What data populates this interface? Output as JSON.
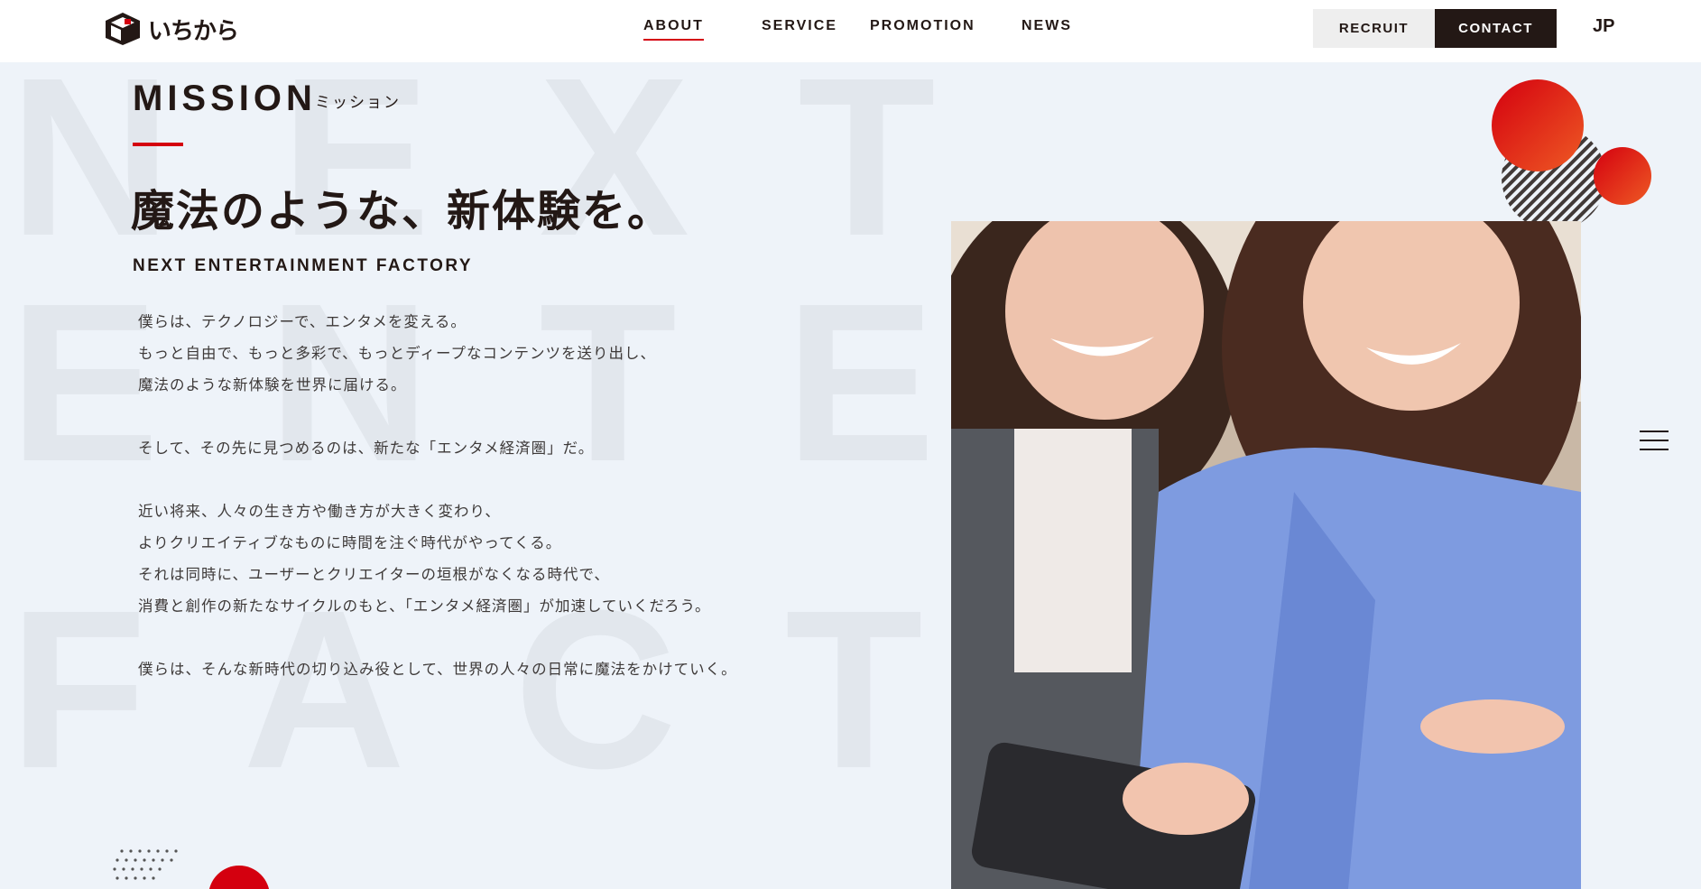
{
  "header": {
    "logo_text": "いちから",
    "nav": [
      {
        "label": "ABOUT",
        "active": true
      },
      {
        "label": "SERVICE",
        "active": false
      },
      {
        "label": "PROMOTION",
        "active": false
      },
      {
        "label": "NEWS",
        "active": false
      }
    ],
    "recruit_label": "RECRUIT",
    "contact_label": "CONTACT",
    "lang_label": "JP"
  },
  "background_text": {
    "row1": "NEXT",
    "row2": "ENTE",
    "row3": "FACTO"
  },
  "mission": {
    "heading": "MISSION",
    "subheading": "ミッション",
    "catch_copy": "魔法のような、新体験を。",
    "catch_en": "NEXT ENTERTAINMENT FACTORY",
    "paragraphs": [
      [
        "僕らは、テクノロジーで、エンタメを変える。",
        "もっと自由で、もっと多彩で、もっとディープなコンテンツを送り出し、",
        "魔法のような新体験を世界に届ける。"
      ],
      [
        "そして、その先に見つめるのは、新たな「エンタメ経済圏」だ。"
      ],
      [
        "近い将来、人々の生き方や働き方が大きく変わり、",
        "よりクリエイティブなものに時間を注ぐ時代がやってくる。",
        "それは同時に、ユーザーとクリエイターの垣根がなくなる時代で、",
        "消費と創作の新たなサイクルのもと、「エンタメ経済圏」が加速していくだろう。"
      ],
      [
        "僕らは、そんな新時代の切り込み役として、世界の人々の日常に魔法をかけていく。"
      ]
    ]
  },
  "colors": {
    "accent": "#d4000f",
    "dark": "#231815",
    "background": "#eef3f9"
  },
  "icons": [
    "logo-cube-icon",
    "hamburger-menu-icon"
  ]
}
